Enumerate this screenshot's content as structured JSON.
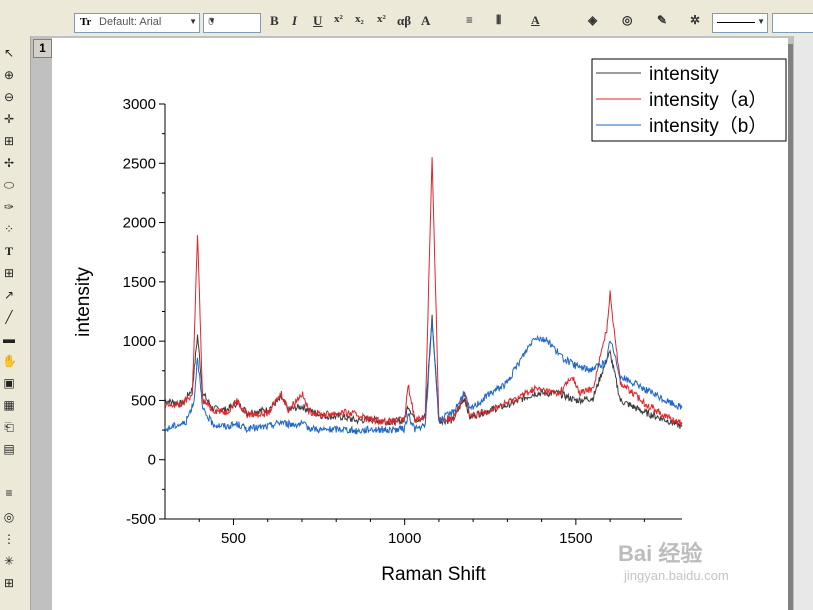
{
  "toolbar": {
    "font_name": "Default: Arial",
    "font_size": "0",
    "tt_glyph": "Tr",
    "fmt": [
      "B",
      "I",
      "U",
      "x²",
      "x₂",
      "x²",
      "αβ",
      "A"
    ]
  },
  "page_tab": "1",
  "colors": {
    "black_series": "#3a3a3a",
    "red_series": "#e0252b",
    "blue_series": "#1e66c8"
  },
  "chart_data": {
    "type": "line",
    "xlabel": "Raman Shift",
    "ylabel": "intensity",
    "xlim": [
      300,
      1810
    ],
    "ylim": [
      -500,
      3000
    ],
    "xticks": [
      500,
      1000,
      1500
    ],
    "yticks": [
      -500,
      0,
      500,
      1000,
      1500,
      2000,
      2500,
      3000
    ],
    "legend_position": "top-right",
    "series": [
      {
        "name": "intensity",
        "color": "#3a3a3a",
        "x": [
          300,
          350,
          380,
          395,
          410,
          440,
          480,
          510,
          540,
          600,
          640,
          660,
          700,
          720,
          760,
          820,
          860,
          900,
          960,
          1000,
          1010,
          1030,
          1060,
          1080,
          1100,
          1140,
          1175,
          1190,
          1250,
          1300,
          1380,
          1450,
          1500,
          1550,
          1590,
          1600,
          1630,
          1700,
          1760,
          1810
        ],
        "y": [
          500,
          470,
          600,
          1050,
          560,
          430,
          420,
          480,
          400,
          420,
          520,
          420,
          450,
          420,
          370,
          360,
          330,
          340,
          320,
          330,
          460,
          340,
          360,
          1200,
          330,
          330,
          520,
          360,
          420,
          460,
          560,
          560,
          500,
          520,
          850,
          900,
          500,
          400,
          340,
          280
        ]
      },
      {
        "name": "intensity（a）",
        "color": "#e0252b",
        "x": [
          300,
          350,
          380,
          395,
          410,
          440,
          480,
          510,
          540,
          600,
          640,
          660,
          700,
          720,
          760,
          820,
          860,
          900,
          960,
          1000,
          1010,
          1030,
          1060,
          1080,
          1100,
          1140,
          1175,
          1190,
          1250,
          1300,
          1380,
          1450,
          1490,
          1510,
          1550,
          1590,
          1600,
          1630,
          1700,
          1760,
          1810
        ],
        "y": [
          450,
          470,
          550,
          1900,
          500,
          420,
          400,
          500,
          380,
          390,
          560,
          420,
          560,
          410,
          380,
          400,
          380,
          340,
          320,
          340,
          630,
          340,
          360,
          2550,
          340,
          350,
          560,
          360,
          420,
          480,
          600,
          560,
          700,
          560,
          600,
          1100,
          1400,
          650,
          480,
          370,
          300
        ]
      },
      {
        "name": "intensity（b）",
        "color": "#1e66c8",
        "x": [
          300,
          330,
          360,
          385,
          395,
          410,
          440,
          480,
          510,
          540,
          600,
          640,
          660,
          700,
          720,
          760,
          820,
          860,
          900,
          960,
          1000,
          1010,
          1030,
          1060,
          1080,
          1100,
          1140,
          1175,
          1190,
          1250,
          1300,
          1340,
          1380,
          1420,
          1460,
          1500,
          1540,
          1590,
          1600,
          1630,
          1700,
          1760,
          1810
        ],
        "y": [
          250,
          290,
          310,
          500,
          880,
          420,
          300,
          280,
          300,
          260,
          280,
          320,
          300,
          300,
          270,
          250,
          260,
          240,
          260,
          250,
          260,
          380,
          260,
          280,
          1180,
          330,
          400,
          560,
          420,
          560,
          650,
          850,
          1040,
          1000,
          860,
          790,
          760,
          820,
          1020,
          700,
          600,
          500,
          440
        ]
      }
    ]
  },
  "watermark": {
    "main": "Bai 经验",
    "sub": "jingyan.baidu.com"
  }
}
